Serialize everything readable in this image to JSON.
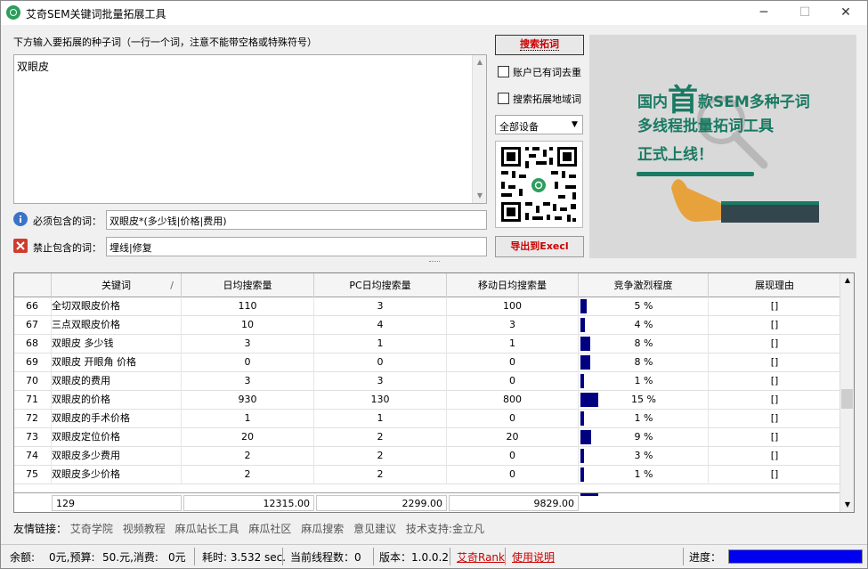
{
  "window": {
    "title": "艾奇SEM关键词批量拓展工具",
    "controls": [
      "─",
      "☐",
      "✕"
    ]
  },
  "seed": {
    "label": "下方输入要拓展的种子词（一行一个词，注意不能带空格或特殊符号）",
    "value": "双眼皮"
  },
  "filters": {
    "include_label": "必须包含的词：",
    "include_value": "双眼皮*(多少钱|价格|费用)",
    "exclude_label": "禁止包含的词：",
    "exclude_value": "埋线|修复"
  },
  "actions": {
    "search_label": "搜索拓词",
    "dedupe_label": "账户已有词去重",
    "region_label": "搜索拓展地域词",
    "device_selected": "全部设备",
    "export_label": "导出到Execl"
  },
  "promo": {
    "line1_prefix": "国内",
    "line1_big": "首",
    "line1_suffix": "款SEM多种子词",
    "line2": "多线程批量拓词工具",
    "line3": "正式上线！"
  },
  "table": {
    "columns": [
      "关键词",
      "日均搜索量",
      "PC日均搜索量",
      "移动日均搜索量",
      "竞争激烈程度",
      "展现理由"
    ],
    "sort_indicator": "/",
    "rows": [
      {
        "idx": "66",
        "kw": "全切双眼皮价格",
        "daily": "110",
        "pc": "3",
        "mobile": "100",
        "comp": "5 %",
        "comp_value": 5,
        "reason": "[]"
      },
      {
        "idx": "67",
        "kw": "三点双眼皮价格",
        "daily": "10",
        "pc": "4",
        "mobile": "3",
        "comp": "4 %",
        "comp_value": 4,
        "reason": "[]"
      },
      {
        "idx": "68",
        "kw": "双眼皮 多少钱",
        "daily": "3",
        "pc": "1",
        "mobile": "1",
        "comp": "8 %",
        "comp_value": 8,
        "reason": "[]"
      },
      {
        "idx": "69",
        "kw": "双眼皮 开眼角 价格",
        "daily": "0",
        "pc": "0",
        "mobile": "0",
        "comp": "8 %",
        "comp_value": 8,
        "reason": "[]"
      },
      {
        "idx": "70",
        "kw": "双眼皮的费用",
        "daily": "3",
        "pc": "3",
        "mobile": "0",
        "comp": "1 %",
        "comp_value": 1,
        "reason": "[]"
      },
      {
        "idx": "71",
        "kw": "双眼皮的价格",
        "daily": "930",
        "pc": "130",
        "mobile": "800",
        "comp": "15 %",
        "comp_value": 15,
        "reason": "[]"
      },
      {
        "idx": "72",
        "kw": "双眼皮的手术价格",
        "daily": "1",
        "pc": "1",
        "mobile": "0",
        "comp": "1 %",
        "comp_value": 1,
        "reason": "[]"
      },
      {
        "idx": "73",
        "kw": "双眼皮定位价格",
        "daily": "20",
        "pc": "2",
        "mobile": "20",
        "comp": "9 %",
        "comp_value": 9,
        "reason": "[]"
      },
      {
        "idx": "74",
        "kw": "双眼皮多少费用",
        "daily": "2",
        "pc": "2",
        "mobile": "0",
        "comp": "3 %",
        "comp_value": 3,
        "reason": "[]"
      },
      {
        "idx": "75",
        "kw": "双眼皮多少价格",
        "daily": "2",
        "pc": "2",
        "mobile": "0",
        "comp": "1 %",
        "comp_value": 1,
        "reason": "[]"
      }
    ],
    "footer": {
      "count": "129",
      "daily_total": "12315.00",
      "pc_total": "2299.00",
      "mobile_total": "9829.00"
    }
  },
  "links": {
    "label": "友情链接：",
    "items": [
      "艾奇学院",
      "视频教程",
      "麻瓜站长工具",
      "麻瓜社区",
      "麻瓜搜索",
      "意见建议",
      "技术支持:金立凡"
    ]
  },
  "status": {
    "balance": "余额:",
    "balance_text": "0元,预算:",
    "budget_text": "50.元,消费:",
    "spend_text": "0元",
    "elapsed": "耗时: 3.532 sec.",
    "threads": "当前线程数：0",
    "version": "版本：1.0.0.2",
    "rank_link": "艾奇Rank",
    "help_link": "使用说明",
    "progress_label": "进度：",
    "progress_value": 1.0
  },
  "colors": {
    "bar": "#000080",
    "progress": "#0000f0",
    "accent_red": "#c00000",
    "promo_green": "#1a7a63"
  }
}
